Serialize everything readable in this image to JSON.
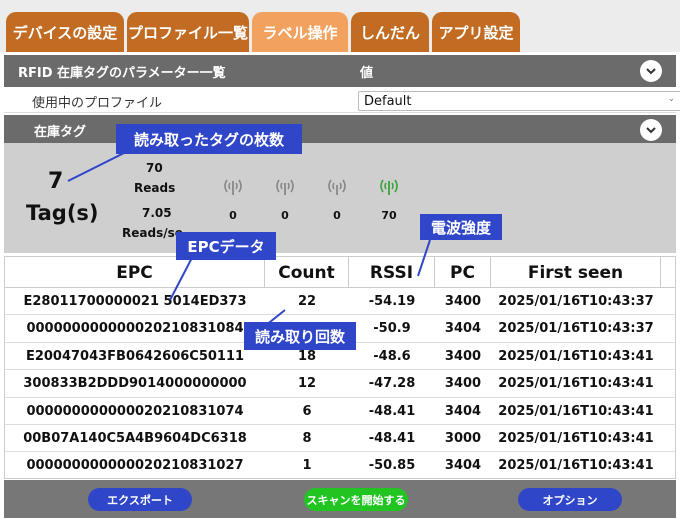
{
  "tabs": [
    {
      "label": "デバイスの設定"
    },
    {
      "label": "プロファイル一覧"
    },
    {
      "label": "ラベル操作"
    },
    {
      "label": "しんだん"
    },
    {
      "label": "アプリ設定"
    }
  ],
  "params_header": {
    "title": "RFID 在庫タグのパラメーター一覧",
    "value_col": "値"
  },
  "profile": {
    "label": "使用中のプロファイル",
    "value": "Default"
  },
  "inventory_header": {
    "title": "在庫タグ"
  },
  "stats": {
    "tag_count": "7",
    "tag_unit": "Tag(s)",
    "reads_count": "70",
    "reads_label": "Reads",
    "reads_rate": "7.05",
    "reads_rate_label": "Reads/se"
  },
  "signal_levels": [
    {
      "icon": "signal-weak-icon",
      "value": "0"
    },
    {
      "icon": "signal-low-icon",
      "value": "0"
    },
    {
      "icon": "signal-medium-icon",
      "value": "0"
    },
    {
      "icon": "signal-strong-icon",
      "value": "70",
      "color": "#3aa33a"
    }
  ],
  "table": {
    "headers": [
      "EPC",
      "Count",
      "RSSI",
      "PC",
      "First seen"
    ],
    "rows": [
      [
        "E28011700000021 5014ED373",
        "22",
        "-54.19",
        "3400",
        "2025/01/16T10:43:37"
      ],
      [
        "000000000000020210831084",
        "",
        "-50.9",
        "3404",
        "2025/01/16T10:43:37"
      ],
      [
        "E20047043FB0642606C50111",
        "18",
        "-48.6",
        "3400",
        "2025/01/16T10:43:41"
      ],
      [
        "300833B2DDD9014000000000",
        "12",
        "-47.28",
        "3400",
        "2025/01/16T10:43:41"
      ],
      [
        "000000000000020210831074",
        "6",
        "-48.41",
        "3404",
        "2025/01/16T10:43:41"
      ],
      [
        "00B07A140C5A4B9604DC6318",
        "8",
        "-48.41",
        "3000",
        "2025/01/16T10:43:41"
      ],
      [
        "000000000000020210831027",
        "1",
        "-50.85",
        "3404",
        "2025/01/16T10:43:41"
      ]
    ]
  },
  "footer": {
    "export_label": "エクスポート",
    "scan_label": "スキャンを開始する",
    "options_label": "オプション"
  },
  "annotations": {
    "tag_count_note": "読み取ったタグの枚数",
    "epc_note": "EPCデータ",
    "rssi_note": "電波強度",
    "count_note": "読み取り回数"
  },
  "colors": {
    "tab": "#c26b22",
    "tab_active": "#f2a25e",
    "callout": "#2f46c8",
    "scan_button": "#22c422",
    "nav_button": "#2f46c8"
  }
}
